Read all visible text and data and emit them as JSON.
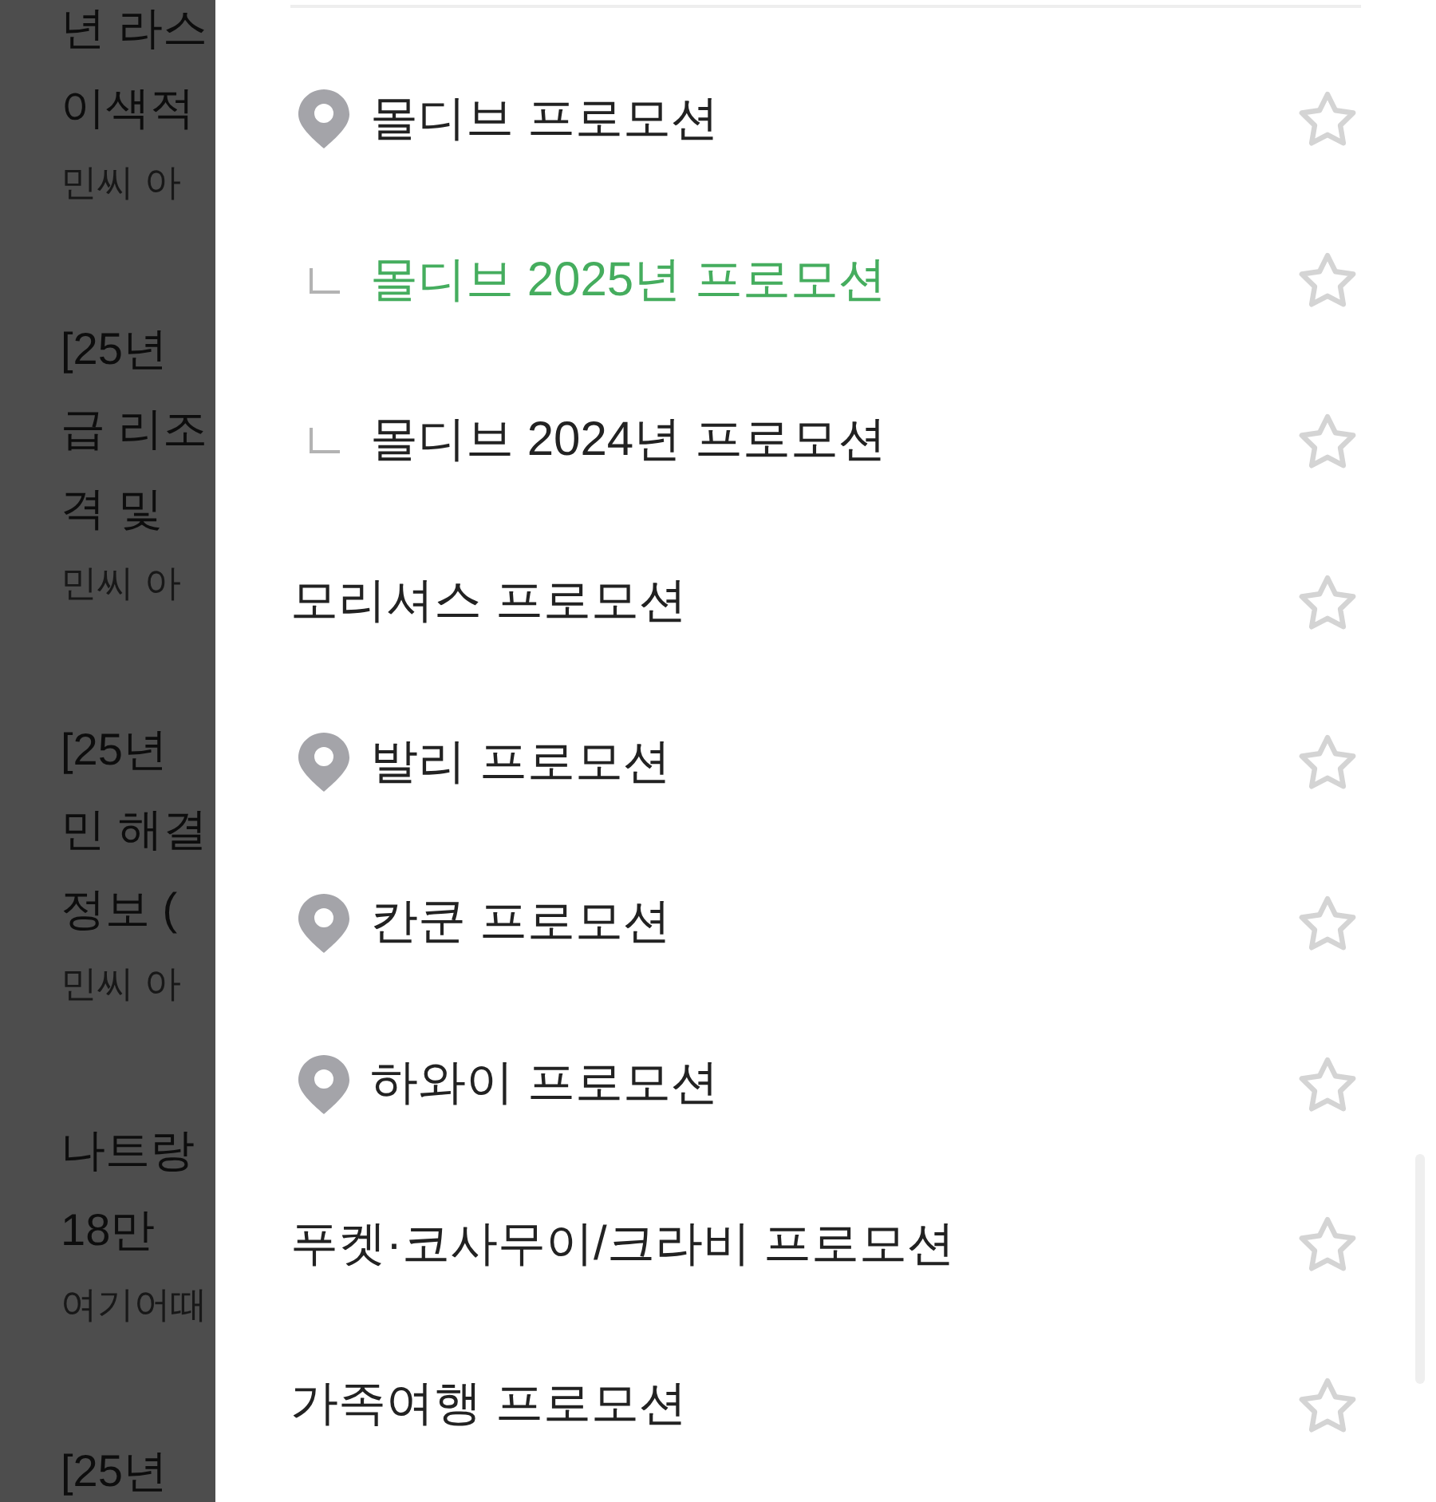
{
  "feed": {
    "posts": [
      {
        "title_lines": [
          "년 라스",
          "이색적"
        ],
        "source": "민씨 아"
      },
      {
        "title_lines": [
          "[25년",
          "급 리조",
          "격 및"
        ],
        "source": "민씨 아"
      },
      {
        "title_lines": [
          "[25년",
          "민 해결",
          "정보 ("
        ],
        "source": "민씨 아"
      },
      {
        "title_lines": [
          "나트랑",
          "18만"
        ],
        "source": "여기어때"
      },
      {
        "title_lines": [
          "[25년"
        ]
      }
    ]
  },
  "drawer": {
    "items": [
      {
        "kind": "location",
        "label": "몰디브 프로모션",
        "selected": false,
        "favorite": false,
        "children": [
          {
            "label": "몰디브 2025년 프로모션",
            "selected": true,
            "favorite": false
          },
          {
            "label": "몰디브 2024년 프로모션",
            "selected": false,
            "favorite": false
          }
        ]
      },
      {
        "kind": "plain",
        "label": "모리셔스 프로모션",
        "selected": false,
        "favorite": false
      },
      {
        "kind": "location",
        "label": "발리 프로모션",
        "selected": false,
        "favorite": false
      },
      {
        "kind": "location",
        "label": "칸쿤 프로모션",
        "selected": false,
        "favorite": false
      },
      {
        "kind": "location",
        "label": "하와이 프로모션",
        "selected": false,
        "favorite": false
      },
      {
        "kind": "plain",
        "label": "푸켓·코사무이/크라비 프로모션",
        "selected": false,
        "favorite": false
      },
      {
        "kind": "plain",
        "label": "가족여행 프로모션",
        "selected": false,
        "favorite": false
      }
    ]
  }
}
